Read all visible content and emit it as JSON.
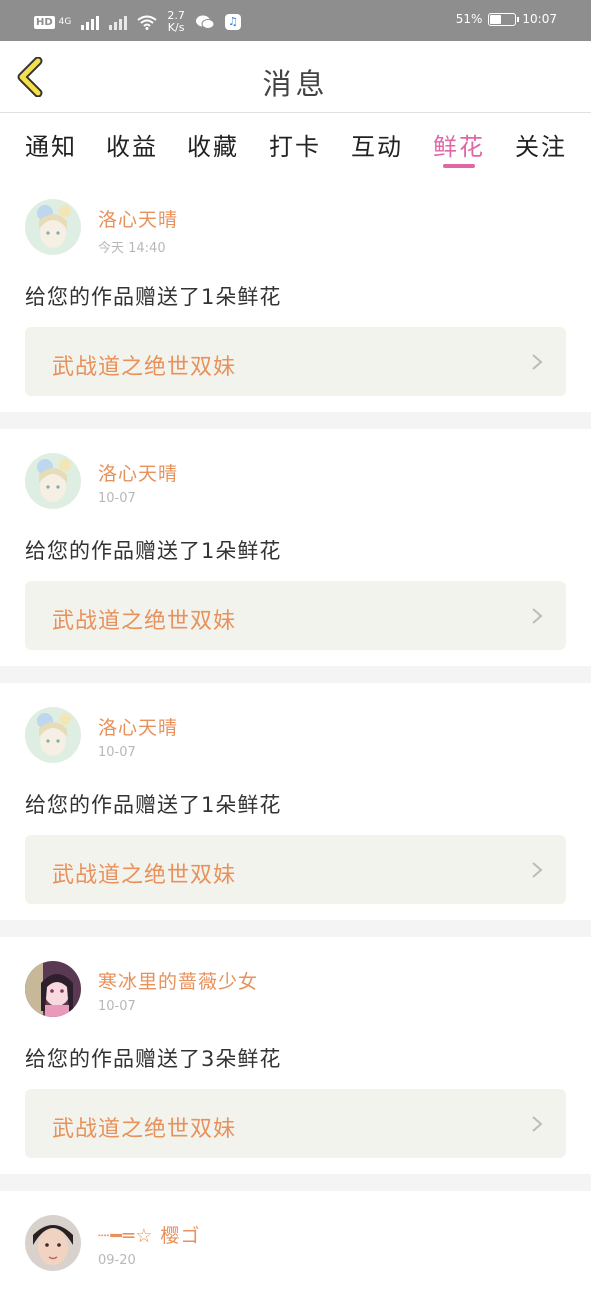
{
  "status_bar": {
    "hd": "HD",
    "net": "4G",
    "speed_value": "2.7",
    "speed_unit": "K/s",
    "battery": "51%",
    "battery_level": 0.51,
    "time": "10:07",
    "icons": [
      "hd-icon",
      "signal-icon",
      "wifi-icon",
      "wechat-icon",
      "music-app-icon",
      "battery-icon"
    ]
  },
  "header": {
    "title": "消息",
    "back_icon": "chevron-left-icon"
  },
  "tabs": [
    {
      "label": "通知"
    },
    {
      "label": "收益"
    },
    {
      "label": "收藏"
    },
    {
      "label": "打卡"
    },
    {
      "label": "互动"
    },
    {
      "label": "鲜花",
      "active": true
    },
    {
      "label": "关注"
    }
  ],
  "colors": {
    "accent_pink": "#e066a6",
    "username_orange": "#e8915a",
    "back_arrow_yellow": "#f4e04a",
    "card_box_bg": "#f3f3ee"
  },
  "messages": [
    {
      "user": "洛心天晴",
      "time": "今天 14:40",
      "text": "给您的作品赠送了1朵鲜花",
      "work": "武战道之绝世双妹",
      "avatar": "anime-girl-avatar"
    },
    {
      "user": "洛心天晴",
      "time": "10-07",
      "text": "给您的作品赠送了1朵鲜花",
      "work": "武战道之绝世双妹",
      "avatar": "anime-girl-avatar"
    },
    {
      "user": "洛心天晴",
      "time": "10-07",
      "text": "给您的作品赠送了1朵鲜花",
      "work": "武战道之绝世双妹",
      "avatar": "anime-girl-avatar"
    },
    {
      "user": "寒冰里的蔷薇少女",
      "time": "10-07",
      "text": "给您的作品赠送了3朵鲜花",
      "work": "武战道之绝世双妹",
      "avatar": "pink-anime-avatar"
    },
    {
      "user": "┈━═☆ 樱ゴ",
      "time": "09-20",
      "text": "",
      "work": "",
      "avatar": "photo-girl-avatar"
    }
  ]
}
